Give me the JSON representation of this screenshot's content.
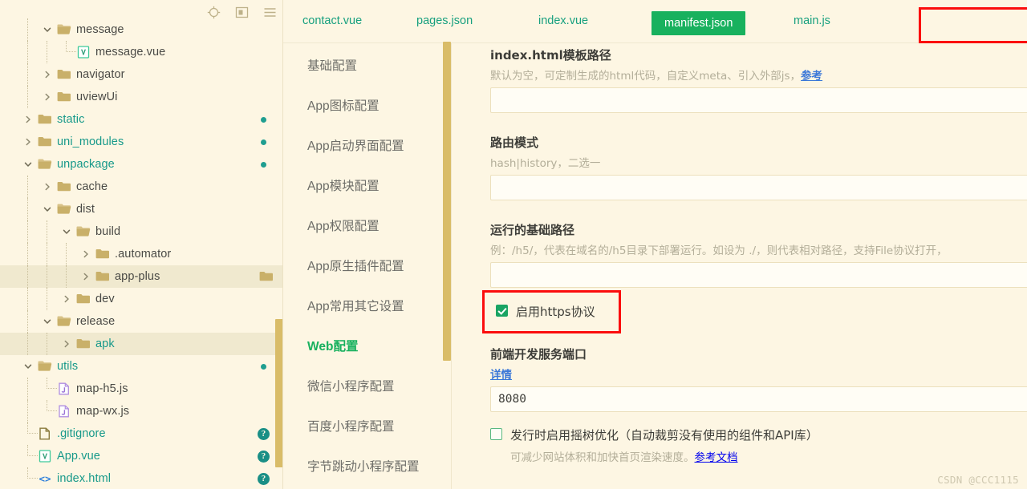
{
  "colors": {
    "background": "#fdf6e3",
    "accent_green": "#18b15e",
    "teal_text": "#17998a",
    "highlight_red": "#fb0d0d",
    "scrollbar": "#d9bc68",
    "selected_row": "#f0e9cf"
  },
  "sidebar": {
    "toolbar": [
      {
        "icon": "locate-target-icon"
      },
      {
        "icon": "collapse-panel-icon"
      },
      {
        "icon": "hamburger-menu-icon"
      }
    ],
    "tree": [
      {
        "label": "message",
        "depth": 2,
        "type": "folder",
        "state": "expanded",
        "color": "dark",
        "status": ""
      },
      {
        "label": "message.vue",
        "depth": 3,
        "type": "vue",
        "state": "leaf",
        "color": "dark",
        "status": ""
      },
      {
        "label": "navigator",
        "depth": 2,
        "type": "folder",
        "state": "collapsed",
        "color": "dark",
        "status": ""
      },
      {
        "label": "uviewUi",
        "depth": 2,
        "type": "folder",
        "state": "collapsed",
        "color": "dark",
        "status": ""
      },
      {
        "label": "static",
        "depth": 1,
        "type": "folder",
        "state": "collapsed",
        "color": "teal",
        "status": "dot"
      },
      {
        "label": "uni_modules",
        "depth": 1,
        "type": "folder",
        "state": "collapsed",
        "color": "teal",
        "status": "dot"
      },
      {
        "label": "unpackage",
        "depth": 1,
        "type": "folder",
        "state": "expanded",
        "color": "teal",
        "status": "dot"
      },
      {
        "label": "cache",
        "depth": 2,
        "type": "folder",
        "state": "collapsed",
        "color": "dark",
        "status": ""
      },
      {
        "label": "dist",
        "depth": 2,
        "type": "folder",
        "state": "expanded",
        "color": "dark",
        "status": ""
      },
      {
        "label": "build",
        "depth": 3,
        "type": "folder",
        "state": "expanded",
        "color": "dark",
        "status": ""
      },
      {
        "label": ".automator",
        "depth": 4,
        "type": "folder",
        "state": "collapsed",
        "color": "dark",
        "status": ""
      },
      {
        "label": "app-plus",
        "depth": 4,
        "type": "folder",
        "state": "collapsed",
        "color": "dark",
        "status": "endfolder",
        "selected": true
      },
      {
        "label": "dev",
        "depth": 3,
        "type": "folder",
        "state": "collapsed",
        "color": "dark",
        "status": ""
      },
      {
        "label": "release",
        "depth": 2,
        "type": "folder",
        "state": "expanded",
        "color": "dark",
        "status": ""
      },
      {
        "label": "apk",
        "depth": 3,
        "type": "folder",
        "state": "collapsed",
        "color": "teal",
        "status": "",
        "selected": true
      },
      {
        "label": "utils",
        "depth": 1,
        "type": "folder",
        "state": "expanded",
        "color": "teal",
        "status": "dot"
      },
      {
        "label": "map-h5.js",
        "depth": 2,
        "type": "js",
        "state": "leaf",
        "color": "dark",
        "status": ""
      },
      {
        "label": "map-wx.js",
        "depth": 2,
        "type": "js",
        "state": "leaf",
        "color": "dark",
        "status": ""
      },
      {
        "label": ".gitignore",
        "depth": 1,
        "type": "file",
        "state": "leaf",
        "color": "teal",
        "status": "question"
      },
      {
        "label": "App.vue",
        "depth": 1,
        "type": "vue",
        "state": "leaf",
        "color": "teal",
        "status": "question"
      },
      {
        "label": "index.html",
        "depth": 1,
        "type": "html",
        "state": "leaf",
        "color": "teal",
        "status": "question"
      }
    ]
  },
  "tabs": [
    {
      "label": "contact.vue",
      "active": false
    },
    {
      "label": "pages.json",
      "active": false
    },
    {
      "label": "index.vue",
      "active": false
    },
    {
      "label": "manifest.json",
      "active": true
    },
    {
      "label": "main.js",
      "active": false
    }
  ],
  "config_nav": [
    {
      "label": "基础配置",
      "active": false
    },
    {
      "label": "App图标配置",
      "active": false
    },
    {
      "label": "App启动界面配置",
      "active": false
    },
    {
      "label": "App模块配置",
      "active": false
    },
    {
      "label": "App权限配置",
      "active": false
    },
    {
      "label": "App原生插件配置",
      "active": false
    },
    {
      "label": "App常用其它设置",
      "active": false
    },
    {
      "label": "Web配置",
      "active": true
    },
    {
      "label": "微信小程序配置",
      "active": false
    },
    {
      "label": "百度小程序配置",
      "active": false
    },
    {
      "label": "字节跳动小程序配置",
      "active": false
    }
  ],
  "form": {
    "template_path": {
      "title": "index.html模板路径",
      "hint_pre": "默认为空，可定制生成的html代码，自定义meta、引入外部js，",
      "hint_link": "参考",
      "value": "",
      "placeholder": ""
    },
    "router_mode": {
      "title": "路由模式",
      "hint_pre": "hash|history，二选一",
      "hint_link": "",
      "value": "",
      "placeholder": ""
    },
    "base_path": {
      "title": "运行的基础路径",
      "hint_pre": "例：/h5/，代表在域名的/h5目录下部署运行。如设为 ./，则代表相对路径，支持File协议打开，",
      "hint_link": "",
      "value": "",
      "placeholder": ""
    },
    "https_checkbox": {
      "label": "启用https协议",
      "checked": true
    },
    "dev_port": {
      "title": "前端开发服务端口",
      "hint_link": "详情",
      "value": "8080"
    },
    "treeshaking_checkbox": {
      "label": "发行时启用摇树优化（自动裁剪没有使用的组件和API库）",
      "sub_pre": "可减少网站体积和加快首页渲染速度。",
      "sub_link": "参考文档",
      "checked": false
    }
  },
  "watermark": "CSDN @CCC1115"
}
